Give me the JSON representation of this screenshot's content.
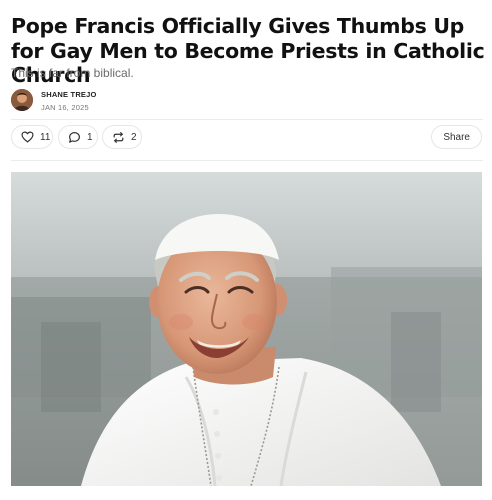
{
  "article": {
    "title": "Pope Francis Officially Gives Thumbs Up for Gay Men to Become Priests in Catholic Church",
    "subtitle": "This is far from biblical.",
    "author": "SHANE TREJO",
    "date": "JAN 16, 2025"
  },
  "actions": {
    "likes": "11",
    "comments": "1",
    "restacks": "2",
    "share_label": "Share"
  },
  "icons": {
    "like": "heart-icon",
    "comment": "comment-icon",
    "restack": "restack-icon"
  },
  "colors": {
    "text": "#111111",
    "muted": "#6b6b6b",
    "border": "#e6e6e6"
  }
}
